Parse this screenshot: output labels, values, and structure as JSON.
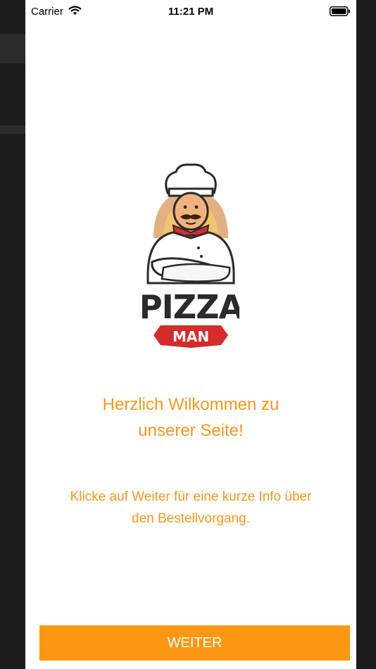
{
  "status_bar": {
    "carrier": "Carrier",
    "time": "11:21 PM",
    "icons": [
      "wifi-icon",
      "battery-icon"
    ]
  },
  "logo": {
    "icon": "pizza-man-chef-logo",
    "wordmark_top": "PIZZA",
    "wordmark_bottom": "MAN"
  },
  "welcome": {
    "title_line1": "Herzlich Wilkommen zu",
    "title_line2": "unserer Seite!",
    "info_line1": "Klicke auf Weiter für eine kurze Info über",
    "info_line2": "den Bestellvorgang."
  },
  "actions": {
    "next_label": "WEITER"
  },
  "colors": {
    "accent": "#f5981f",
    "button": "#fc9713",
    "button_text": "#ffffff",
    "background": "#ffffff",
    "logo_red": "#d42b2b"
  }
}
